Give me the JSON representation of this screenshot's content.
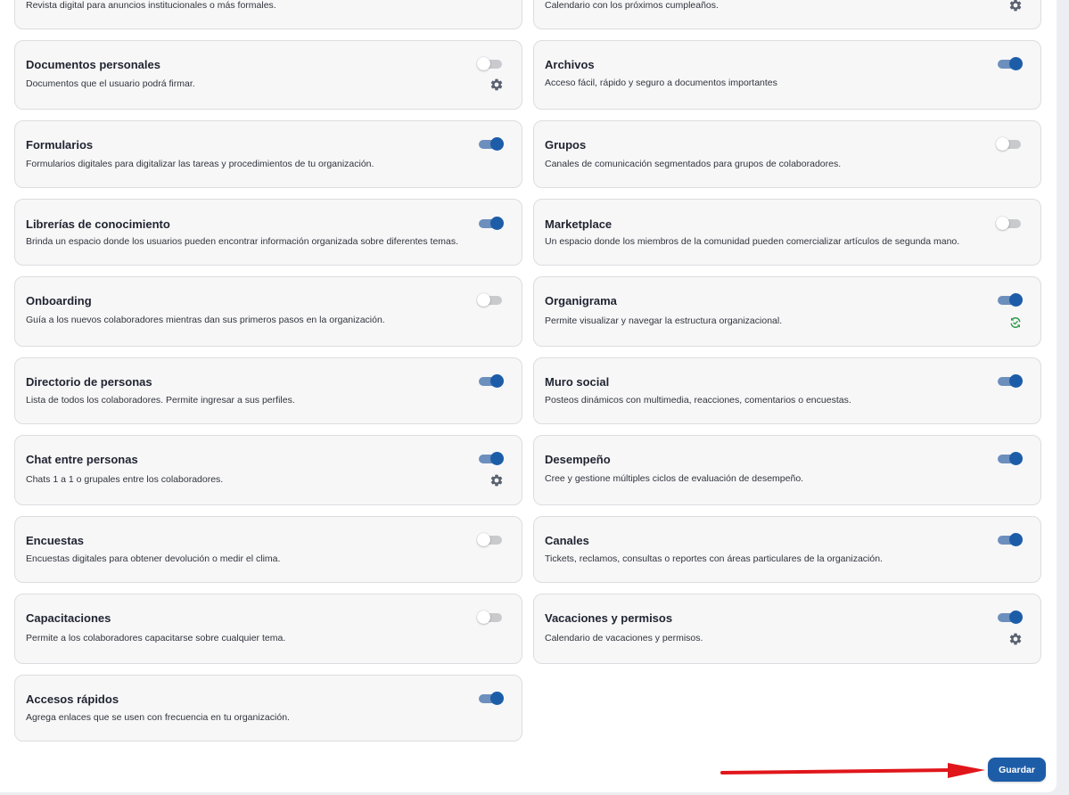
{
  "modules": [
    {
      "title": "",
      "description": "Revista digital para anuncios institucionales o más formales.",
      "enabled": null,
      "settings": false,
      "sync": false
    },
    {
      "title": "",
      "description": "Calendario con los próximos cumpleaños.",
      "enabled": null,
      "settings": true,
      "sync": false
    },
    {
      "title": "Documentos personales",
      "description": "Documentos que el usuario podrá firmar.",
      "enabled": false,
      "settings": true,
      "sync": false
    },
    {
      "title": "Archivos",
      "description": "Acceso fácil, rápido y seguro a documentos importantes",
      "enabled": true,
      "settings": false,
      "sync": false
    },
    {
      "title": "Formularios",
      "description": "Formularios digitales para digitalizar las tareas y procedimientos de tu organización.",
      "enabled": true,
      "settings": false,
      "sync": false
    },
    {
      "title": "Grupos",
      "description": "Canales de comunicación segmentados para grupos de colaboradores.",
      "enabled": false,
      "settings": false,
      "sync": false
    },
    {
      "title": "Librerías de conocimiento",
      "description": "Brinda un espacio donde los usuarios pueden encontrar información organizada sobre diferentes temas.",
      "enabled": true,
      "settings": false,
      "sync": false
    },
    {
      "title": "Marketplace",
      "description": "Un espacio donde los miembros de la comunidad pueden comercializar artículos de segunda mano.",
      "enabled": false,
      "settings": false,
      "sync": false
    },
    {
      "title": "Onboarding",
      "description": "Guía a los nuevos colaboradores mientras dan sus primeros pasos en la organización.",
      "enabled": false,
      "settings": false,
      "sync": false
    },
    {
      "title": "Organigrama",
      "description": "Permite visualizar y navegar la estructura organizacional.",
      "enabled": true,
      "settings": false,
      "sync": true
    },
    {
      "title": "Directorio de personas",
      "description": "Lista de todos los colaboradores. Permite ingresar a sus perfiles.",
      "enabled": true,
      "settings": false,
      "sync": false
    },
    {
      "title": "Muro social",
      "description": "Posteos dinámicos con multimedia, reacciones, comentarios o encuestas.",
      "enabled": true,
      "settings": false,
      "sync": false
    },
    {
      "title": "Chat entre personas",
      "description": "Chats 1 a 1 o grupales entre los colaboradores.",
      "enabled": true,
      "settings": true,
      "sync": false
    },
    {
      "title": "Desempeño",
      "description": "Cree y gestione múltiples ciclos de evaluación de desempeño.",
      "enabled": true,
      "settings": false,
      "sync": false
    },
    {
      "title": "Encuestas",
      "description": "Encuestas digitales para obtener devolución o medir el clima.",
      "enabled": false,
      "settings": false,
      "sync": false
    },
    {
      "title": "Canales",
      "description": "Tickets, reclamos, consultas o reportes con áreas particulares de la organización.",
      "enabled": true,
      "settings": false,
      "sync": false
    },
    {
      "title": "Capacitaciones",
      "description": "Permite a los colaboradores capacitarse sobre cualquier tema.",
      "enabled": false,
      "settings": false,
      "sync": false
    },
    {
      "title": "Vacaciones y permisos",
      "description": "Calendario de vacaciones y permisos.",
      "enabled": true,
      "settings": true,
      "sync": false
    },
    {
      "title": "Accesos rápidos",
      "description": "Agrega enlaces que se usen con frecuencia en tu organización.",
      "enabled": true,
      "settings": false,
      "sync": false
    }
  ],
  "icons": {
    "settings": "gear-icon",
    "sync": "sync-icon"
  },
  "colors": {
    "accent": "#1d5da8",
    "toggle_on_track": "#6c8fbd",
    "toggle_off_track": "#c9cacd",
    "sync": "#2e9a4a",
    "annotation_arrow": "#e0161b"
  },
  "footer": {
    "save_label": "Guardar"
  }
}
